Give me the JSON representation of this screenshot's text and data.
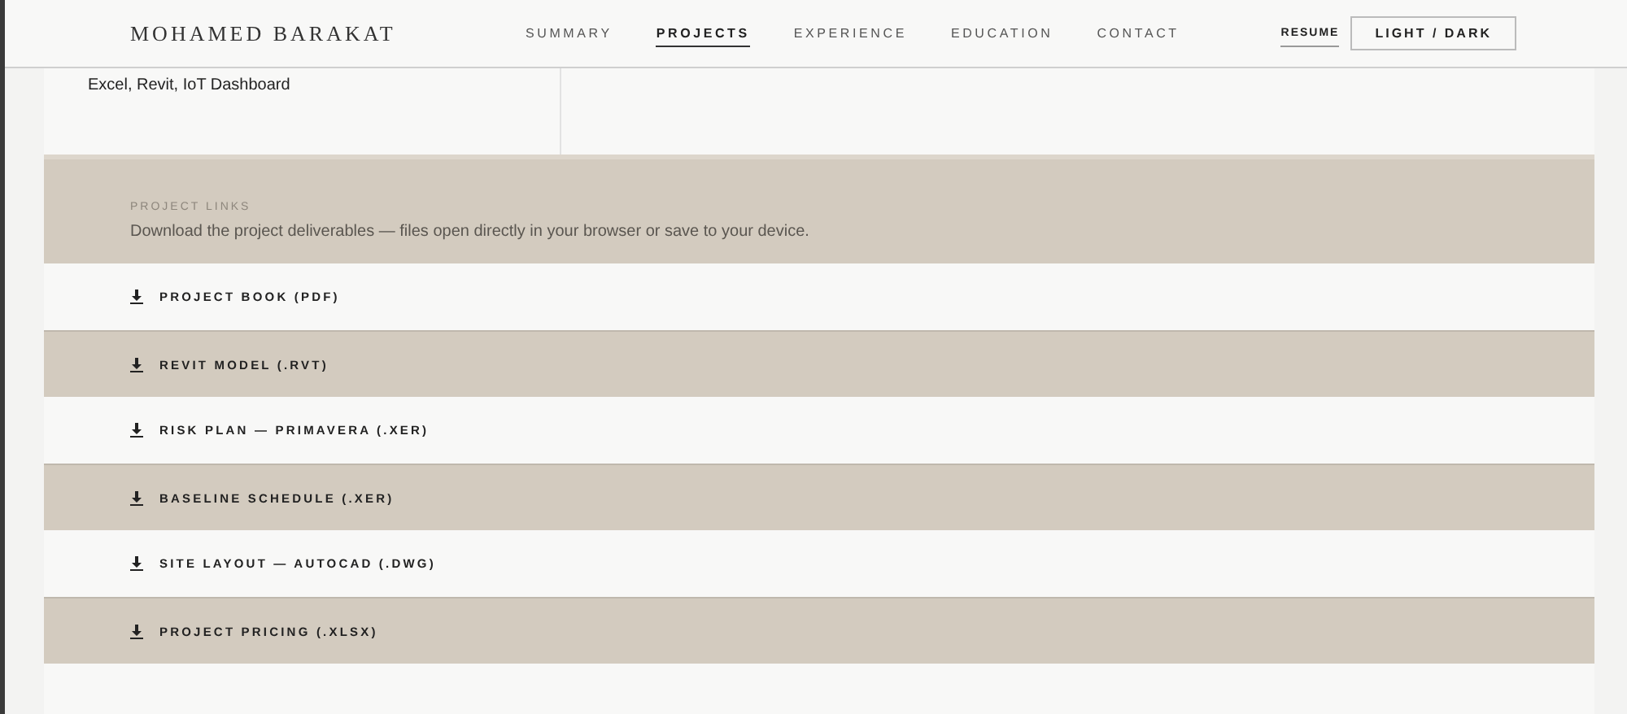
{
  "header": {
    "brand": "MOHAMED BARAKAT",
    "nav": [
      {
        "label": "SUMMARY",
        "selected": false
      },
      {
        "label": "PROJECTS",
        "selected": true
      },
      {
        "label": "EXPERIENCE",
        "selected": false
      },
      {
        "label": "EDUCATION",
        "selected": false
      },
      {
        "label": "CONTACT",
        "selected": false
      }
    ],
    "resume": {
      "label": "RESUME",
      "selected": true
    },
    "theme_button": "LIGHT / DARK"
  },
  "details": {
    "tools": "Excel, Revit, IoT Dashboard"
  },
  "project_links": {
    "heading": "PROJECT LINKS",
    "description": "Download the project deliverables — files open directly in your browser or save to your device.",
    "links": [
      "PROJECT BOOK (PDF)",
      "REVIT MODEL (.RVT)",
      "RISK PLAN — PRIMAVERA (.XER)",
      "BASELINE SCHEDULE (.XER)",
      "SITE LAYOUT — AUTOCAD (.DWG)",
      "PROJECT PRICING (.XLSX)"
    ]
  }
}
